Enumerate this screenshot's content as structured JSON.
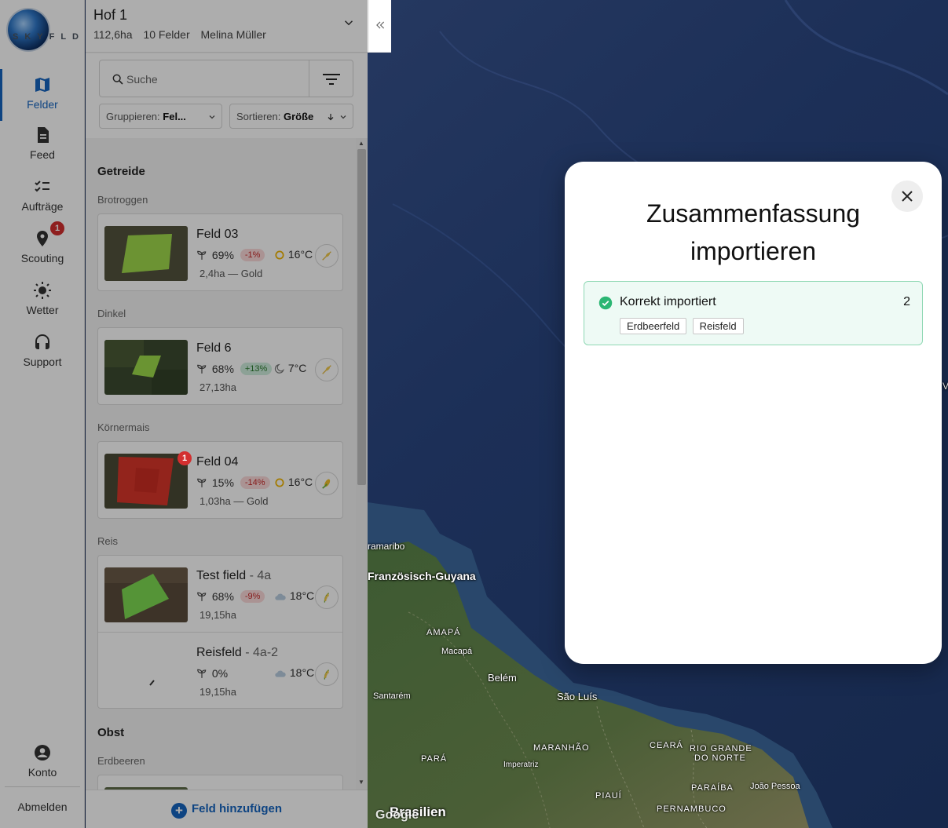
{
  "brand": {
    "logo_text": "SKYFLD"
  },
  "nav": {
    "items": [
      {
        "id": "felder",
        "label": "Felder",
        "icon": "map-icon",
        "active": true
      },
      {
        "id": "feed",
        "label": "Feed",
        "icon": "document-icon"
      },
      {
        "id": "auftraege",
        "label": "Aufträge",
        "icon": "checklist-icon"
      },
      {
        "id": "scouting",
        "label": "Scouting",
        "icon": "location-pin-icon",
        "badge": "1"
      },
      {
        "id": "wetter",
        "label": "Wetter",
        "icon": "sun-icon"
      },
      {
        "id": "support",
        "label": "Support",
        "icon": "headset-icon"
      }
    ],
    "account_label": "Konto",
    "logout_label": "Abmelden"
  },
  "farm": {
    "name": "Hof 1",
    "area": "112,6ha",
    "field_count": "10 Felder",
    "owner": "Melina Müller"
  },
  "toolbar": {
    "search_placeholder": "Suche",
    "group_label": "Gruppieren:",
    "group_value": "Fel...",
    "sort_label": "Sortieren:",
    "sort_value": "Größe"
  },
  "groups": [
    {
      "title": "Getreide",
      "crops": [
        {
          "title": "Brotroggen",
          "fields": [
            {
              "name": "Feld 03",
              "suffix": "",
              "ndvi": "69%",
              "delta": "-1%",
              "delta_type": "neg",
              "weather": "sun",
              "temp": "16°C",
              "area": "2,4ha — Gold",
              "crop_icon": "grain-icon"
            }
          ]
        },
        {
          "title": "Dinkel",
          "fields": [
            {
              "name": "Feld 6",
              "suffix": "",
              "ndvi": "68%",
              "delta": "+13%",
              "delta_type": "pos",
              "weather": "moon",
              "temp": "7°C",
              "area": "27,13ha",
              "crop_icon": "grain-icon"
            }
          ]
        },
        {
          "title": "Körnermais",
          "fields": [
            {
              "name": "Feld 04",
              "suffix": "",
              "ndvi": "15%",
              "delta": "-14%",
              "delta_type": "neg",
              "weather": "sun",
              "temp": "16°C",
              "area": "1,03ha — Gold",
              "crop_icon": "corn-icon",
              "badge": "1"
            }
          ]
        },
        {
          "title": "Reis",
          "fields": [
            {
              "name": "Test field",
              "suffix": " - 4a",
              "ndvi": "68%",
              "delta": "-9%",
              "delta_type": "neg",
              "weather": "cloud",
              "temp": "18°C",
              "area": "19,15ha",
              "crop_icon": "rice-icon"
            },
            {
              "name": "Reisfeld",
              "suffix": " - 4a-2",
              "ndvi": "0%",
              "delta": "",
              "delta_type": "",
              "weather": "cloud",
              "temp": "18°C",
              "area": "19,15ha",
              "crop_icon": "rice-icon"
            }
          ]
        }
      ]
    },
    {
      "title": "Obst",
      "crops": [
        {
          "title": "Erdbeeren",
          "fields": []
        }
      ]
    }
  ],
  "add_field_label": "Feld hinzufügen",
  "map": {
    "labels": [
      "ramaribo",
      "Französisch-Guyana",
      "AMAPÁ",
      "Macapá",
      "Belém",
      "Santarém",
      "São Luís",
      "MARANHÃO",
      "PARÁ",
      "Imperatriz",
      "CEARÁ",
      "RIO GRANDE",
      "DO NORTE",
      "PARAÍBA",
      "João Pessoa",
      "PIAUÍ",
      "PERNAMBUCO",
      "Brasilien",
      "V"
    ],
    "attribution": "Google"
  },
  "modal": {
    "title": "Zusammenfassung importieren",
    "result_label": "Korrekt importiert",
    "result_count": "2",
    "imported_fields": [
      "Erdbeerfeld",
      "Reisfeld"
    ],
    "success_color": "#2bb673"
  }
}
